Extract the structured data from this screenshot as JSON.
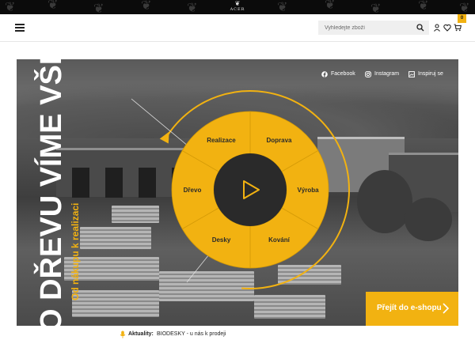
{
  "brand": {
    "logo_text": "ACER"
  },
  "header": {
    "search_placeholder": "Vyhledejte zboží",
    "cart_count": "0"
  },
  "hero": {
    "title": "O DŘEVU VÍME VŠE",
    "subtitle": "Od nákupu k realizaci",
    "social": [
      {
        "label": "Facebook",
        "icon": "facebook-icon"
      },
      {
        "label": "Instagram",
        "icon": "instagram-icon"
      },
      {
        "label": "Inspiruj se",
        "icon": "inspire-icon"
      }
    ],
    "wheel": {
      "segments": [
        "Doprava",
        "Výroba",
        "Kování",
        "Desky",
        "Dřevo",
        "Realizace"
      ],
      "color": "#f2b211"
    },
    "cta_label": "Přejít do e-shopu"
  },
  "news": {
    "label": "Aktuality:",
    "text": "BIODESKY - u nás k prodeji"
  },
  "colors": {
    "accent": "#f2b211",
    "dark": "#0b0b0b"
  }
}
